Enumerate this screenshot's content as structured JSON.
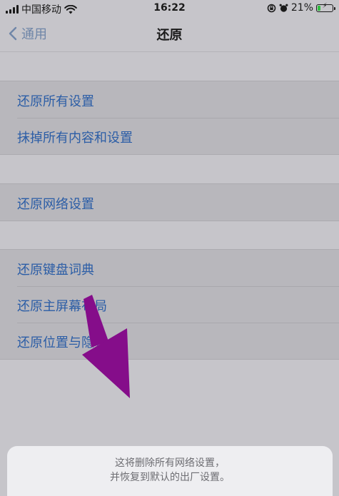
{
  "status": {
    "carrier": "中国移动",
    "time": "16:22",
    "battery_percent": "21%",
    "battery_level": 0.21
  },
  "nav": {
    "back_label": "通用",
    "title": "还原"
  },
  "groups": [
    {
      "items": [
        "还原所有设置",
        "抹掉所有内容和设置"
      ]
    },
    {
      "items": [
        "还原网络设置"
      ]
    },
    {
      "items": [
        "还原键盘词典",
        "还原主屏幕布局",
        "还原位置与隐私"
      ]
    }
  ],
  "sheet": {
    "line1": "这将删除所有网络设置，",
    "line2": "并恢复到默认的出厂设置。"
  },
  "colors": {
    "arrow": "#850d8a",
    "link": "#2b5da6"
  }
}
